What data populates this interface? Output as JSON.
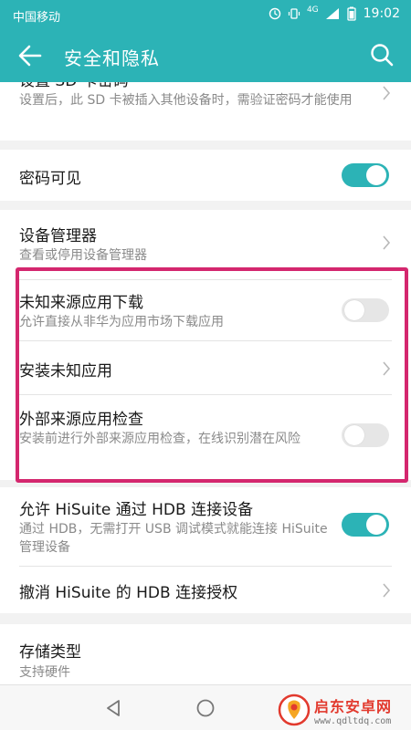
{
  "status_bar": {
    "carrier": "中国移动",
    "network": "4G",
    "time": "19:02"
  },
  "app_bar": {
    "title": "安全和隐私"
  },
  "settings": {
    "sd_card": {
      "title": "设置 SD 卡密码",
      "subtitle": "设置后，此 SD 卡被插入其他设备时，需验证密码才能使用"
    },
    "password_visible": {
      "title": "密码可见",
      "enabled": true
    },
    "device_admin": {
      "title": "设备管理器",
      "subtitle": "查看或停用设备管理器"
    },
    "unknown_source_download": {
      "title": "未知来源应用下载",
      "subtitle": "允许直接从非华为应用市场下载应用",
      "enabled": false
    },
    "install_unknown_apps": {
      "title": "安装未知应用"
    },
    "external_source_check": {
      "title": "外部来源应用检查",
      "subtitle": "安装前进行外部来源应用检查，在线识别潜在风险",
      "enabled": false
    },
    "hisuite_hdb": {
      "title": "允许 HiSuite 通过 HDB 连接设备",
      "subtitle": "通过 HDB，无需打开 USB 调试模式就能连接 HiSuite 管理设备",
      "enabled": true
    },
    "revoke_hdb": {
      "title": "撤消 HiSuite 的 HDB 连接授权"
    },
    "storage_type": {
      "title": "存储类型",
      "subtitle": "支持硬件"
    }
  },
  "watermark": {
    "name": "启东安卓网",
    "url": "www.qdltdq.com"
  },
  "colors": {
    "accent": "#2cb3b6",
    "highlight": "#d4276e"
  }
}
